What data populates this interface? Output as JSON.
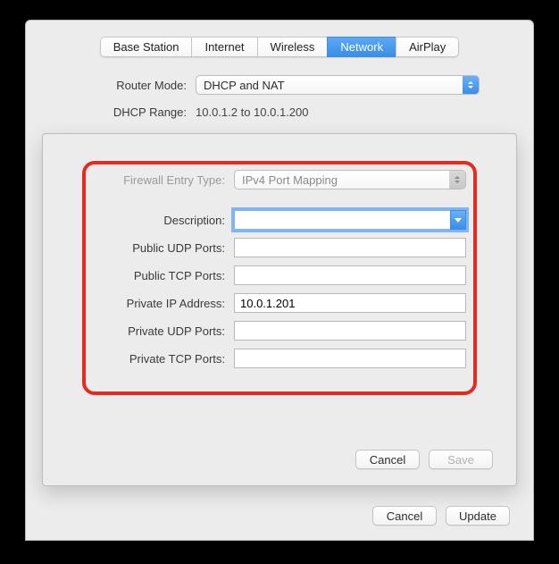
{
  "tabs": {
    "base_station": "Base Station",
    "internet": "Internet",
    "wireless": "Wireless",
    "network": "Network",
    "airplay": "AirPlay"
  },
  "main": {
    "router_mode_label": "Router Mode:",
    "router_mode_value": "DHCP and NAT",
    "dhcp_range_label": "DHCP Range:",
    "dhcp_range_value": "10.0.1.2 to 10.0.1.200"
  },
  "sheet": {
    "firewall_entry_type_label": "Firewall Entry Type:",
    "firewall_entry_type_value": "IPv4 Port Mapping",
    "description_label": "Description:",
    "description_value": "",
    "public_udp_label": "Public UDP Ports:",
    "public_udp_value": "",
    "public_tcp_label": "Public TCP Ports:",
    "public_tcp_value": "",
    "private_ip_label": "Private IP Address:",
    "private_ip_value": "10.0.1.201",
    "private_udp_label": "Private UDP Ports:",
    "private_udp_value": "",
    "private_tcp_label": "Private TCP Ports:",
    "private_tcp_value": "",
    "cancel": "Cancel",
    "save": "Save"
  },
  "footer": {
    "cancel": "Cancel",
    "update": "Update"
  }
}
